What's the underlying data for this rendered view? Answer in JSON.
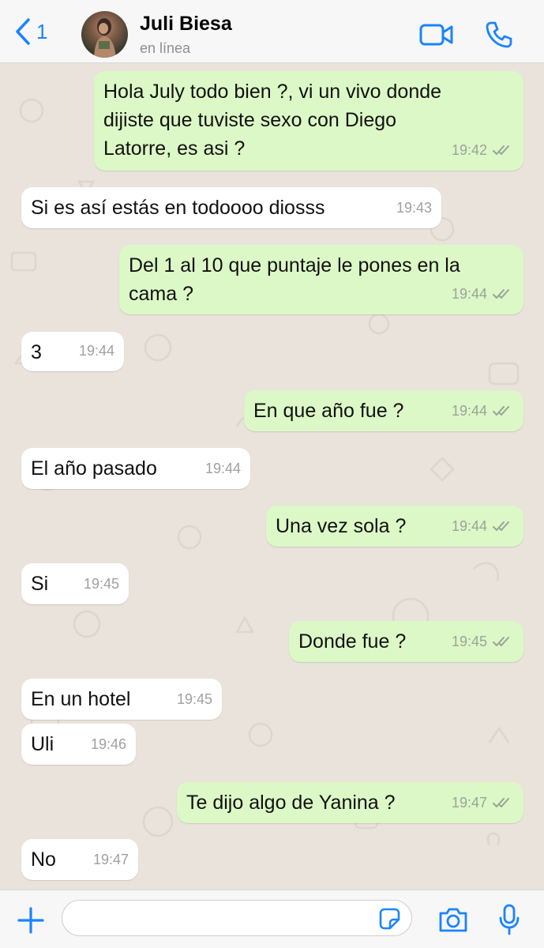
{
  "header": {
    "back_count": "1",
    "contact_name": "Juli Biesa",
    "status": "en línea"
  },
  "messages": [
    {
      "dir": "out",
      "lines": [
        "Hola July todo bien ?, vi un vivo donde",
        "dijiste que tuviste sexo con Diego",
        "Latorre, es asi ?"
      ],
      "time": "19:42"
    },
    {
      "dir": "in",
      "lines": [
        "Si es así estás en todoooo diosss"
      ],
      "time": "19:43"
    },
    {
      "dir": "out",
      "lines": [
        "Del 1 al 10 que puntaje le pones en la",
        "cama ?"
      ],
      "time": "19:44"
    },
    {
      "dir": "in",
      "lines": [
        "3"
      ],
      "time": "19:44"
    },
    {
      "dir": "out",
      "lines": [
        "En que año fue ?"
      ],
      "time": "19:44"
    },
    {
      "dir": "in",
      "lines": [
        "El año pasado"
      ],
      "time": "19:44"
    },
    {
      "dir": "out",
      "lines": [
        "Una vez sola ?"
      ],
      "time": "19:44"
    },
    {
      "dir": "in",
      "lines": [
        "Si"
      ],
      "time": "19:45"
    },
    {
      "dir": "out",
      "lines": [
        "Donde fue ?"
      ],
      "time": "19:45"
    },
    {
      "dir": "in",
      "lines": [
        "En un hotel"
      ],
      "time": "19:45"
    },
    {
      "dir": "in",
      "lines": [
        "Uli"
      ],
      "time": "19:46"
    },
    {
      "dir": "out",
      "lines": [
        "Te dijo algo de Yanina ?"
      ],
      "time": "19:47"
    },
    {
      "dir": "in",
      "lines": [
        "No"
      ],
      "time": "19:47"
    }
  ],
  "composer": {
    "placeholder": ""
  },
  "colors": {
    "accent": "#1a84ff",
    "outgoing_bubble": "#dcf8c6",
    "incoming_bubble": "#ffffff",
    "chat_background": "#e9e3db"
  },
  "icons": {
    "back": "chevron-left-icon",
    "video": "video-camera-icon",
    "call": "phone-icon",
    "attach": "plus-icon",
    "sticker": "sticker-icon",
    "camera": "camera-icon",
    "mic": "microphone-icon"
  }
}
